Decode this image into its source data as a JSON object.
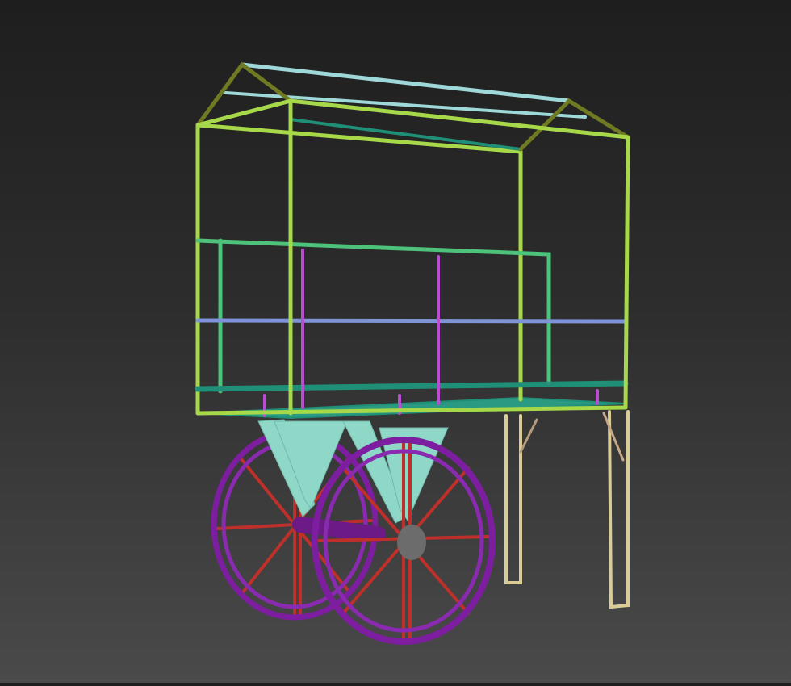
{
  "viewport": {
    "subject": "cart-model",
    "colors": {
      "frame": "#a6d84a",
      "roof_rail": "#9ed8d8",
      "roof_gable": "#6f7a22",
      "teal": "#1f8f78",
      "rail_green": "#4cc27a",
      "blue_rail": "#7f93d8",
      "post": "#b84fd0",
      "legs": "#d9cc96",
      "wheel_rim": "#7d1ea0",
      "spokes": "#c0302a",
      "support": "#8fd8c8"
    }
  }
}
